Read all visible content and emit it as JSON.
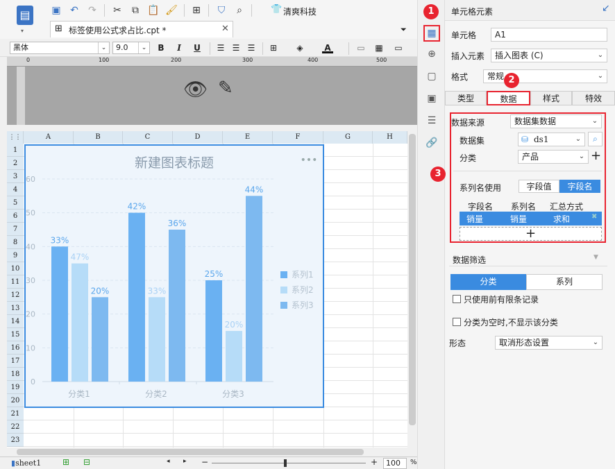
{
  "tab": {
    "filename": "标签使用公式求占比.cpt *"
  },
  "toolbar": {
    "company": "清爽科技"
  },
  "format": {
    "font": "黑体",
    "size": "9.0",
    "bold": "B",
    "italic": "I",
    "underline": "U"
  },
  "ruler": {
    "ticks": [
      "0",
      "100",
      "200",
      "300",
      "400",
      "500"
    ]
  },
  "columns": [
    "A",
    "B",
    "C",
    "D",
    "E",
    "F",
    "G",
    "H"
  ],
  "rows": [
    "1",
    "2",
    "3",
    "4",
    "5",
    "6",
    "7",
    "8",
    "9",
    "10",
    "11",
    "12",
    "13",
    "14",
    "15",
    "16",
    "17",
    "18",
    "19",
    "20",
    "21",
    "22",
    "23"
  ],
  "status": {
    "sheet": "sheet1",
    "zoom": "100",
    "percent": "%"
  },
  "chart_data": {
    "type": "bar",
    "title": "新建图表标题",
    "categories": [
      "分类1",
      "分类2",
      "分类3"
    ],
    "series": [
      {
        "name": "系列1",
        "values": [
          40,
          50,
          30
        ],
        "labels": [
          "33%",
          "42%",
          "25%"
        ],
        "color": "#6ab1f2"
      },
      {
        "name": "系列2",
        "values": [
          35,
          25,
          15
        ],
        "labels": [
          "47%",
          "33%",
          "20%"
        ],
        "color": "#b6dcf8"
      },
      {
        "name": "系列3",
        "values": [
          25,
          45,
          55
        ],
        "labels": [
          "20%",
          "36%",
          "44%"
        ],
        "color": "#7db9f0"
      }
    ],
    "ylim": [
      0,
      60
    ],
    "yticks": [
      "0",
      "10",
      "20",
      "30",
      "40",
      "50",
      "60"
    ],
    "legend": "right"
  },
  "panel": {
    "title": "单元格元素",
    "cell_label": "单元格",
    "cell_value": "A1",
    "insert_label": "插入元素",
    "insert_value": "插入图表 (C)",
    "format_label": "格式",
    "format_value": "常规",
    "tabs": [
      "类型",
      "数据",
      "样式",
      "特效"
    ],
    "source_label": "数据来源",
    "source_value": "数据集数据",
    "dataset_label": "数据集",
    "dataset_value": "ds1",
    "category_label": "分类",
    "category_value": "产品",
    "series_name_label": "系列名使用",
    "series_opt1": "字段值",
    "series_opt2": "字段名",
    "table_headers": [
      "字段名",
      "系列名",
      "汇总方式"
    ],
    "table_row": [
      "销量",
      "销量",
      "求和"
    ],
    "add": "+",
    "filter_label": "数据筛选",
    "filter_tabs": [
      "分类",
      "系列"
    ],
    "check1": "只使用前有限条记录",
    "check2": "分类为空时,不显示该分类",
    "shape_label": "形态",
    "shape_value": "取消形态设置"
  },
  "badges": [
    "1",
    "2",
    "3"
  ]
}
